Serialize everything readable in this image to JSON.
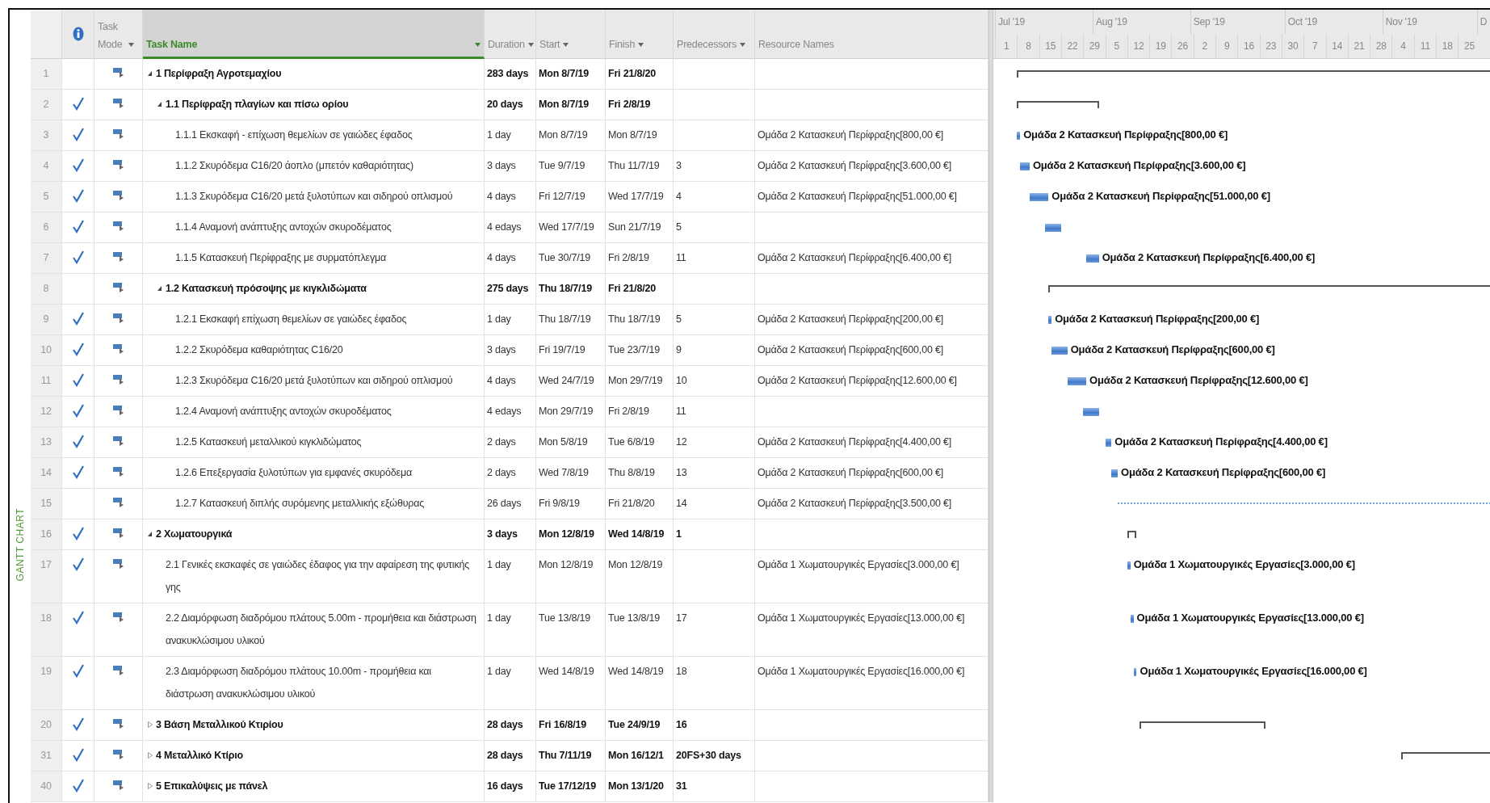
{
  "view_label": "GANTT CHART",
  "columns": [
    {
      "kind": "icon",
      "selected": false,
      "filter": false
    },
    {
      "kind": "text",
      "label": "Task Mode",
      "selected": false,
      "filter": true
    },
    {
      "kind": "text",
      "label": "Task Name",
      "selected": true,
      "filter": true
    },
    {
      "kind": "text",
      "label": "Duration",
      "selected": false,
      "filter": true
    },
    {
      "kind": "text",
      "label": "Start",
      "selected": false,
      "filter": true
    },
    {
      "kind": "text",
      "label": "Finish",
      "selected": false,
      "filter": true
    },
    {
      "kind": "text",
      "label": "Predecessors",
      "selected": false,
      "filter": true
    },
    {
      "kind": "text",
      "label": "Resource Names",
      "selected": false,
      "filter": false
    }
  ],
  "tasks": [
    {
      "row": "1",
      "kind": "summary",
      "expanded": true,
      "done": false,
      "name": "1 Περίφραξη Αγροτεμαχίου",
      "duration": "283 days",
      "start": "Mon 8/7/19",
      "finish": "Fri 21/8/20",
      "children": [
        {
          "row": "2",
          "kind": "summary",
          "expanded": true,
          "done": true,
          "name": "1.1 Περίφραξη πλαγίων και πίσω ορίου",
          "duration": "20 days",
          "start": "Mon 8/7/19",
          "finish": "Fri 2/8/19",
          "children": [
            {
              "row": "3",
              "kind": "task",
              "done": true,
              "name": "1.1.1 Εκσκαφή - επίχωση θεμελίων σε γαιώδες έφαδος",
              "duration": "1 day",
              "start": "Mon 8/7/19",
              "finish": "Mon 8/7/19",
              "resources": "Ομάδα 2 Κατασκευή Περίφραξης[800,00 €]",
              "bar_label": "Ομάδα 2 Κατασκευή Περίφραξης[800,00 €]"
            },
            {
              "row": "4",
              "kind": "task",
              "done": true,
              "name": "1.1.2 Σκυρόδεμα C16/20 άοπλο (μπετόν καθαριότητας)",
              "duration": "3 days",
              "start": "Tue 9/7/19",
              "finish": "Thu 11/7/19",
              "predecessors": "3",
              "resources": "Ομάδα 2 Κατασκευή Περίφραξης[3.600,00 €]",
              "bar_label": "Ομάδα 2 Κατασκευή Περίφραξης[3.600,00 €]"
            },
            {
              "row": "5",
              "kind": "task",
              "done": true,
              "name": "1.1.3 Σκυρόδεμα C16/20 μετά ξυλοτύπων και σιδηρού οπλισμού",
              "duration": "4 days",
              "start": "Fri 12/7/19",
              "finish": "Wed 17/7/19",
              "predecessors": "4",
              "resources": "Ομάδα 2 Κατασκευή Περίφραξης[51.000,00 €]",
              "bar_label": "Ομάδα 2 Κατασκευή Περίφραξης[51.000,00 €]"
            },
            {
              "row": "6",
              "kind": "task",
              "done": true,
              "name": "1.1.4 Αναμονή ανάπτυξης αντοχών σκυροδέματος",
              "duration": "4 edays",
              "start": "Wed 17/7/19",
              "finish": "Sun 21/7/19",
              "predecessors": "5"
            },
            {
              "row": "7",
              "kind": "task",
              "done": true,
              "name": "1.1.5 Κατασκευή Περίφραξης με συρματόπλεγμα",
              "duration": "4 days",
              "start": "Tue 30/7/19",
              "finish": "Fri 2/8/19",
              "predecessors": "11",
              "resources": "Ομάδα 2 Κατασκευή Περίφραξης[6.400,00 €]",
              "bar_label": "Ομάδα 2 Κατασκευή Περίφραξης[6.400,00 €]"
            }
          ]
        },
        {
          "row": "8",
          "kind": "summary",
          "expanded": true,
          "done": false,
          "name": "1.2 Κατασκευή πρόσοψης με κιγκλιδώματα",
          "duration": "275 days",
          "start": "Thu 18/7/19",
          "finish": "Fri 21/8/20",
          "children": [
            {
              "row": "9",
              "kind": "task",
              "done": true,
              "name": "1.2.1 Εκσκαφή επίχωση θεμελίων σε γαιώδες έφαδος",
              "duration": "1 day",
              "start": "Thu 18/7/19",
              "finish": "Thu 18/7/19",
              "predecessors": "5",
              "resources": "Ομάδα 2 Κατασκευή Περίφραξης[200,00 €]",
              "bar_label": "Ομάδα 2 Κατασκευή Περίφραξης[200,00 €]"
            },
            {
              "row": "10",
              "kind": "task",
              "done": true,
              "name": "1.2.2 Σκυρόδεμα καθαριότητας C16/20",
              "duration": "3 days",
              "start": "Fri 19/7/19",
              "finish": "Tue 23/7/19",
              "predecessors": "9",
              "resources": "Ομάδα 2 Κατασκευή Περίφραξης[600,00 €]",
              "bar_label": "Ομάδα 2 Κατασκευή Περίφραξης[600,00 €]"
            },
            {
              "row": "11",
              "kind": "task",
              "done": true,
              "name": "1.2.3 Σκυρόδεμα C16/20 μετά ξυλοτύπων και σιδηρού οπλισμού",
              "duration": "4 days",
              "start": "Wed 24/7/19",
              "finish": "Mon 29/7/19",
              "predecessors": "10",
              "resources": "Ομάδα 2 Κατασκευή Περίφραξης[12.600,00 €]",
              "bar_label": "Ομάδα 2 Κατασκευή Περίφραξης[12.600,00 €]"
            },
            {
              "row": "12",
              "kind": "task",
              "done": true,
              "name": "1.2.4 Αναμονή ανάπτυξης αντοχών σκυροδέματος",
              "duration": "4 edays",
              "start": "Mon 29/7/19",
              "finish": "Fri 2/8/19",
              "predecessors": "11"
            },
            {
              "row": "13",
              "kind": "task",
              "done": true,
              "name": "1.2.5 Κατασκευή μεταλλικού κιγκλιδώματος",
              "duration": "2 days",
              "start": "Mon 5/8/19",
              "finish": "Tue 6/8/19",
              "predecessors": "12",
              "resources": "Ομάδα 2 Κατασκευή Περίφραξης[4.400,00 €]",
              "bar_label": "Ομάδα 2 Κατασκευή Περίφραξης[4.400,00 €]"
            },
            {
              "row": "14",
              "kind": "task",
              "done": true,
              "name": "1.2.6 Επεξεργασία ξυλοτύπων για εμφανές σκυρόδεμα",
              "duration": "2 days",
              "start": "Wed 7/8/19",
              "finish": "Thu 8/8/19",
              "predecessors": "13",
              "resources": "Ομάδα 2 Κατασκευή Περίφραξης[600,00 €]",
              "bar_label": "Ομάδα 2 Κατασκευή Περίφραξης[600,00 €]"
            },
            {
              "row": "15",
              "kind": "task",
              "done": false,
              "name": "1.2.7 Κατασκευή διπλής συρόμενης μεταλλικής εξώθυρας",
              "duration": "26 days",
              "start": "Fri 9/8/19",
              "finish": "Fri 21/8/20",
              "predecessors": "14",
              "resources": "Ομάδα 2 Κατασκευή Περίφραξης[3.500,00 €]"
            }
          ]
        }
      ]
    },
    {
      "row": "16",
      "kind": "summary",
      "expanded": true,
      "done": true,
      "name": "2 Χωματουργικά",
      "duration": "3 days",
      "start": "Mon 12/8/19",
      "finish": "Wed 14/8/19",
      "predecessors": "1",
      "children": [
        {
          "row": "17",
          "kind": "task",
          "done": true,
          "name": "2.1 Γενικές εκσκαφές σε γαιώδες έδαφος για την αφαίρεση της φυτικής γης",
          "duration": "1 day",
          "start": "Mon 12/8/19",
          "finish": "Mon 12/8/19",
          "resources": "Ομάδα 1 Χωματουργικές Εργασίες[3.000,00 €]",
          "bar_label": "Ομάδα 1 Χωματουργικές Εργασίες[3.000,00 €]"
        },
        {
          "row": "18",
          "kind": "task",
          "done": true,
          "name": "2.2 Διαμόρφωση διαδρόμου πλάτους 5.00m - προμήθεια και διάστρωση ανακυκλώσιμου υλικού",
          "duration": "1 day",
          "start": "Tue 13/8/19",
          "finish": "Tue 13/8/19",
          "predecessors": "17",
          "resources": "Ομάδα 1 Χωματουργικές Εργασίες[13.000,00 €]",
          "bar_label": "Ομάδα 1 Χωματουργικές Εργασίες[13.000,00 €]"
        },
        {
          "row": "19",
          "kind": "task",
          "done": true,
          "name": "2.3 Διαμόρφωση διαδρόμου πλάτους 10.00m - προμήθεια και διάστρωση ανακυκλώσιμου υλικού",
          "duration": "1 day",
          "start": "Wed 14/8/19",
          "finish": "Wed 14/8/19",
          "predecessors": "18",
          "resources": "Ομάδα 1 Χωματουργικές Εργασίες[16.000,00 €]",
          "bar_label": "Ομάδα 1 Χωματουργικές Εργασίες[16.000,00 €]"
        }
      ]
    },
    {
      "row": "20",
      "kind": "summary",
      "expanded": false,
      "done": true,
      "name": "3 Βάση Μεταλλικού Κτιρίου",
      "duration": "28 days",
      "start": "Fri 16/8/19",
      "finish": "Tue 24/9/19",
      "predecessors": "16"
    },
    {
      "row": "31",
      "kind": "summary",
      "expanded": false,
      "done": true,
      "name": "4 Μεταλλικό Κτίριο",
      "duration": "28 days",
      "start": "Thu 7/11/19",
      "finish": "Mon 16/12/1",
      "predecessors": "20FS+30 days"
    },
    {
      "row": "40",
      "kind": "summary",
      "expanded": false,
      "done": true,
      "name": "5 Επικαλύψεις με πάνελ",
      "duration": "16 days",
      "start": "Tue 17/12/19",
      "finish": "Mon 13/1/20",
      "predecessors": "31"
    }
  ],
  "timescale": {
    "months": [
      "Jul '19",
      "Aug '19",
      "Sep '19",
      "Oct '19",
      "Nov '19",
      "D"
    ],
    "weeks": [
      "1",
      "8",
      "15",
      "22",
      "29",
      "5",
      "12",
      "19",
      "26",
      "2",
      "9",
      "16",
      "23",
      "30",
      "7",
      "14",
      "21",
      "28",
      "4",
      "11",
      "18",
      "25"
    ]
  }
}
